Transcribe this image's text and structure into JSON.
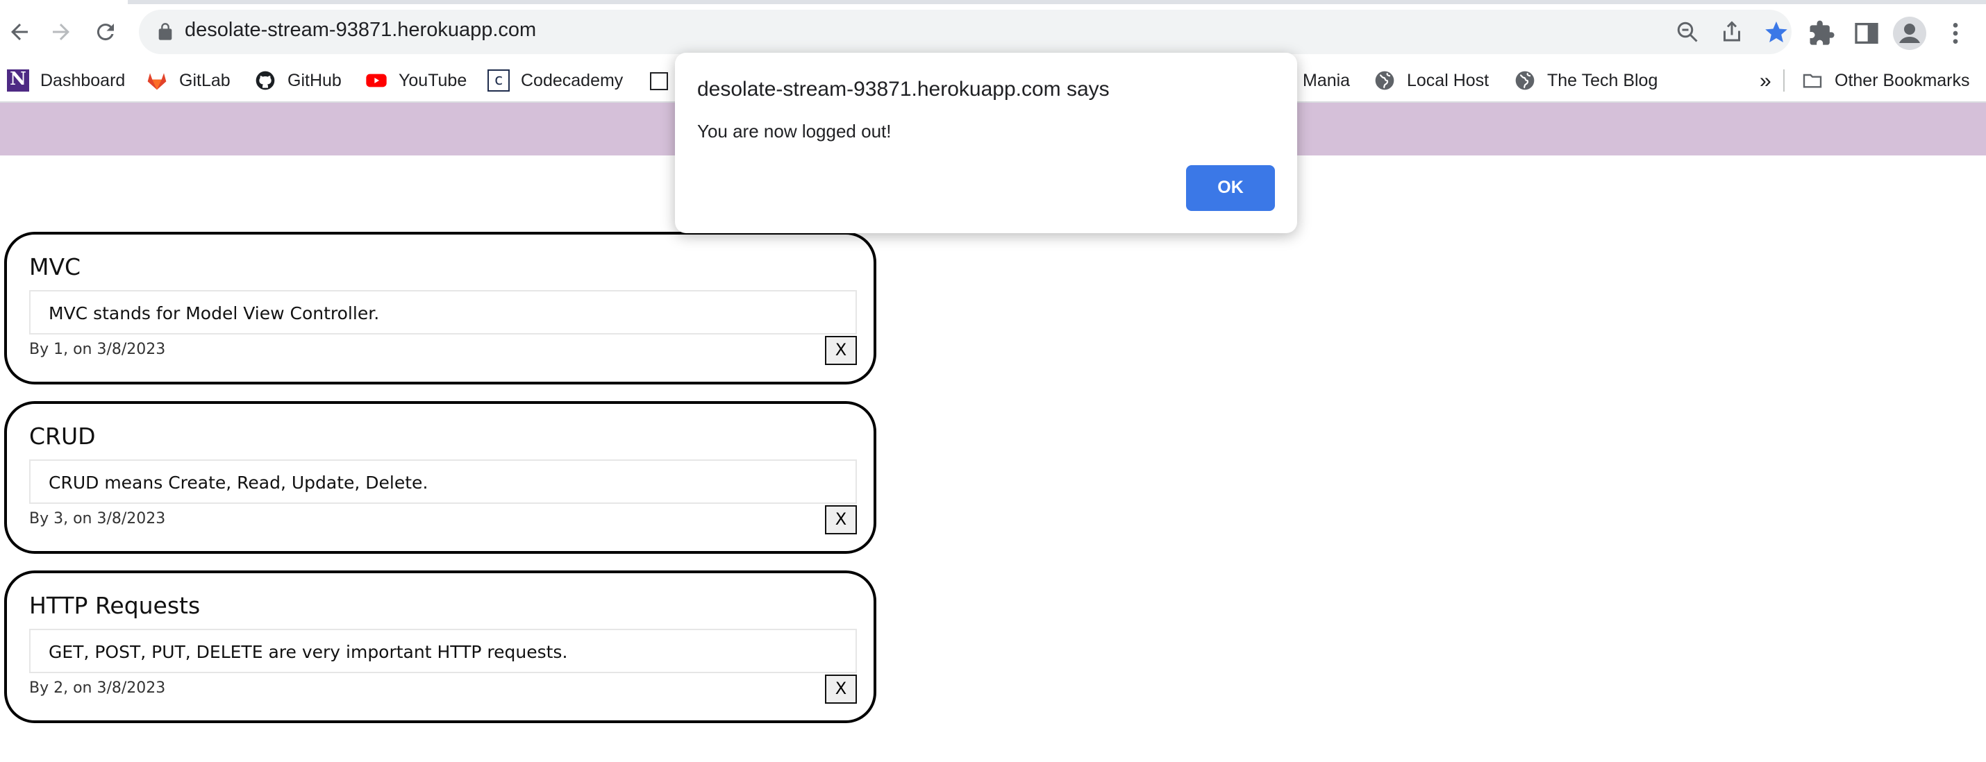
{
  "browser": {
    "url": "desolate-stream-93871.herokuapp.com",
    "bookmarks": [
      {
        "label": "Dashboard",
        "icon": "northwestern-icon"
      },
      {
        "label": "GitLab",
        "icon": "gitlab-icon"
      },
      {
        "label": "GitHub",
        "icon": "github-icon"
      },
      {
        "label": "YouTube",
        "icon": "youtube-icon"
      },
      {
        "label": "Codecademy",
        "icon": "codecademy-icon"
      },
      {
        "label": "",
        "icon": "page-icon"
      },
      {
        "label": "Mania",
        "icon": ""
      },
      {
        "label": "Local Host",
        "icon": "globe-icon"
      },
      {
        "label": "The Tech Blog",
        "icon": "globe-icon"
      }
    ],
    "overflow_label": "»",
    "other_bookmarks_label": "Other Bookmarks",
    "accent_color": "#3b78e7"
  },
  "page": {
    "header_color": "#d5c0d9",
    "posts": [
      {
        "title": "MVC",
        "body": "MVC stands for Model View Controller.",
        "meta": "By 1, on 3/8/2023",
        "delete_label": "X"
      },
      {
        "title": "CRUD",
        "body": "CRUD means Create, Read, Update, Delete.",
        "meta": "By 3, on 3/8/2023",
        "delete_label": "X"
      },
      {
        "title": "HTTP Requests",
        "body": "GET, POST, PUT, DELETE are very important HTTP requests.",
        "meta": "By 2, on 3/8/2023",
        "delete_label": "X"
      }
    ]
  },
  "dialog": {
    "origin": "desolate-stream-93871.herokuapp.com says",
    "message": "You are now logged out!",
    "ok_label": "OK"
  }
}
